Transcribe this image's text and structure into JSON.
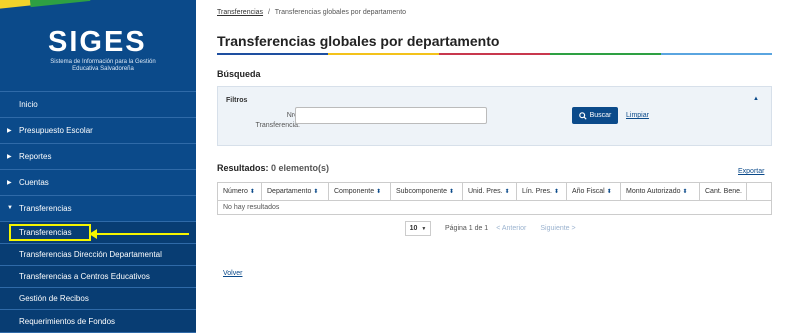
{
  "brand": {
    "title": "SIGES",
    "subtitle": "Sistema de Información para la Gestión Educativa Salvadoreña"
  },
  "sidebar": {
    "items": [
      {
        "label": "Inicio",
        "has_arrow": false
      },
      {
        "label": "Presupuesto Escolar",
        "has_arrow": true
      },
      {
        "label": "Reportes",
        "has_arrow": true
      },
      {
        "label": "Cuentas",
        "has_arrow": true
      },
      {
        "label": "Transferencias",
        "has_arrow": true,
        "expanded": true
      }
    ],
    "subitems": [
      {
        "label": "Transferencias",
        "active": true
      },
      {
        "label": "Transferencias Dirección Departamental"
      },
      {
        "label": "Transferencias a Centros Educativos"
      },
      {
        "label": "Gestión de Recibos"
      },
      {
        "label": "Requerimientos de Fondos"
      }
    ]
  },
  "breadcrumb": {
    "parent": "Transferencias",
    "separator": "/",
    "current": "Transferencias globales por departamento"
  },
  "page_title": "Transferencias globales por departamento",
  "title_bar_colors": [
    "#1e4fa0",
    "#f3c21a",
    "#c8384d",
    "#2ea043",
    "#5aa5e0"
  ],
  "search": {
    "section_title": "Búsqueda",
    "filters_label": "Filtros",
    "field_label": "Nro. Transferencia:",
    "field_value": "",
    "buscar_label": "Buscar",
    "limpiar_label": "Limpiar"
  },
  "results": {
    "title": "Resultados:",
    "count": "0 elemento(s)",
    "export_label": "Exportar",
    "columns": [
      "Número",
      "Departamento",
      "Componente",
      "Subcomponente",
      "Unid. Pres.",
      "Lín. Pres.",
      "Año Fiscal",
      "Monto Autorizado",
      "Cant. Bene.",
      ""
    ],
    "empty_text": "No hay resultados"
  },
  "pager": {
    "page_size": "10",
    "page_info": "Página 1 de 1",
    "prev_label": "< Anterior",
    "next_label": "Siguiente >"
  },
  "volver_label": "Volver",
  "colors": {
    "sidebar": "#0b4a8a",
    "highlight": "#f5f500",
    "accent": "#0b4a8a"
  }
}
